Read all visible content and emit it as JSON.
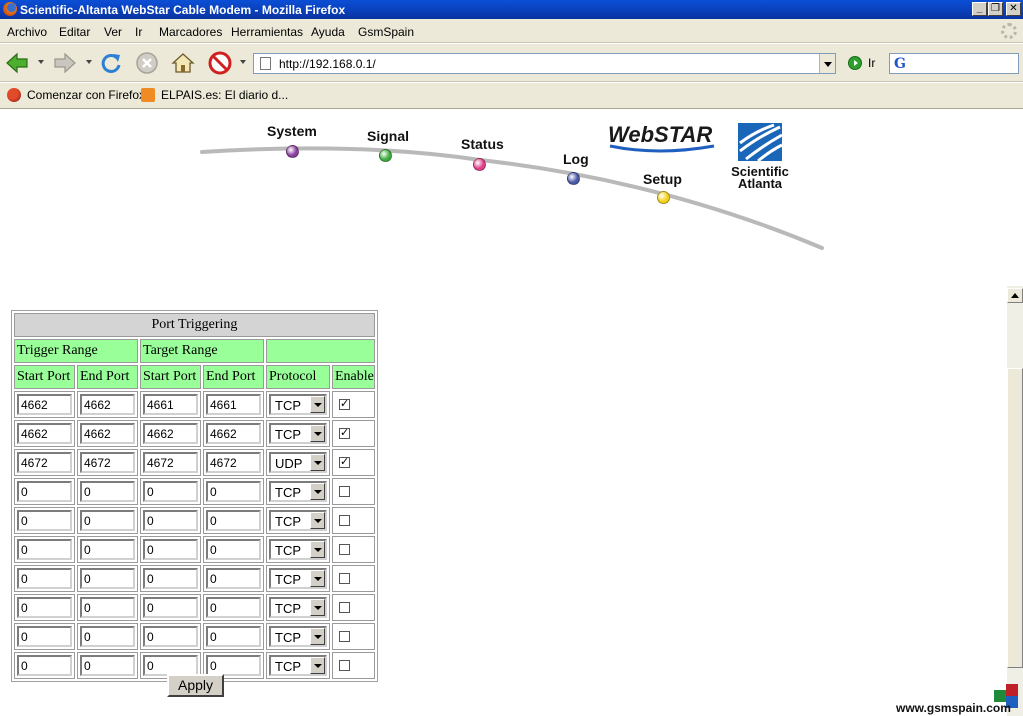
{
  "window": {
    "title": "Scientific-Altanta WebStar Cable Modem - Mozilla Firefox",
    "controls": [
      "_",
      "❐",
      "✕"
    ]
  },
  "menu": [
    "Archivo",
    "Editar",
    "Ver",
    "Ir",
    "Marcadores",
    "Herramientas",
    "Ayuda",
    "GsmSpain"
  ],
  "toolbar": {
    "url": "http://192.168.0.1/",
    "go_label": "Ir",
    "search_placeholder": ""
  },
  "bookmarks": [
    {
      "label": "Comenzar con Firefox",
      "icon": "firefox-icon"
    },
    {
      "label": "ELPAIS.es: El diario d...",
      "icon": "rss-icon"
    }
  ],
  "banner": {
    "nav": [
      {
        "label": "System",
        "color": "#8a3f9e"
      },
      {
        "label": "Signal",
        "color": "#3fae3f"
      },
      {
        "label": "Status",
        "color": "#e0408a"
      },
      {
        "label": "Log",
        "color": "#4a5aa8"
      },
      {
        "label": "Setup",
        "color": "#f2d21a"
      }
    ],
    "webstar_logo": "WebSTAR",
    "sa_logo_line1": "Scientific",
    "sa_logo_line2": "Atlanta"
  },
  "port_triggering": {
    "title": "Port Triggering",
    "group_headers": [
      "Trigger Range",
      "Target Range",
      ""
    ],
    "column_headers": [
      "Start Port",
      "End Port",
      "Start Port",
      "End Port",
      "Protocol",
      "Enable"
    ],
    "rows": [
      {
        "trigger_start": "4662",
        "trigger_end": "4662",
        "target_start": "4661",
        "target_end": "4661",
        "protocol": "TCP",
        "enabled": true
      },
      {
        "trigger_start": "4662",
        "trigger_end": "4662",
        "target_start": "4662",
        "target_end": "4662",
        "protocol": "TCP",
        "enabled": true
      },
      {
        "trigger_start": "4672",
        "trigger_end": "4672",
        "target_start": "4672",
        "target_end": "4672",
        "protocol": "UDP",
        "enabled": true
      },
      {
        "trigger_start": "0",
        "trigger_end": "0",
        "target_start": "0",
        "target_end": "0",
        "protocol": "TCP",
        "enabled": false
      },
      {
        "trigger_start": "0",
        "trigger_end": "0",
        "target_start": "0",
        "target_end": "0",
        "protocol": "TCP",
        "enabled": false
      },
      {
        "trigger_start": "0",
        "trigger_end": "0",
        "target_start": "0",
        "target_end": "0",
        "protocol": "TCP",
        "enabled": false
      },
      {
        "trigger_start": "0",
        "trigger_end": "0",
        "target_start": "0",
        "target_end": "0",
        "protocol": "TCP",
        "enabled": false
      },
      {
        "trigger_start": "0",
        "trigger_end": "0",
        "target_start": "0",
        "target_end": "0",
        "protocol": "TCP",
        "enabled": false
      },
      {
        "trigger_start": "0",
        "trigger_end": "0",
        "target_start": "0",
        "target_end": "0",
        "protocol": "TCP",
        "enabled": false
      },
      {
        "trigger_start": "0",
        "trigger_end": "0",
        "target_start": "0",
        "target_end": "0",
        "protocol": "TCP",
        "enabled": false
      }
    ],
    "apply_label": "Apply"
  },
  "watermark": "www.gsmspain.com",
  "colors": {
    "header_gray": "#d4d4d4",
    "header_green": "#99ff99",
    "titlebar_blue": "#0a3fb8"
  }
}
